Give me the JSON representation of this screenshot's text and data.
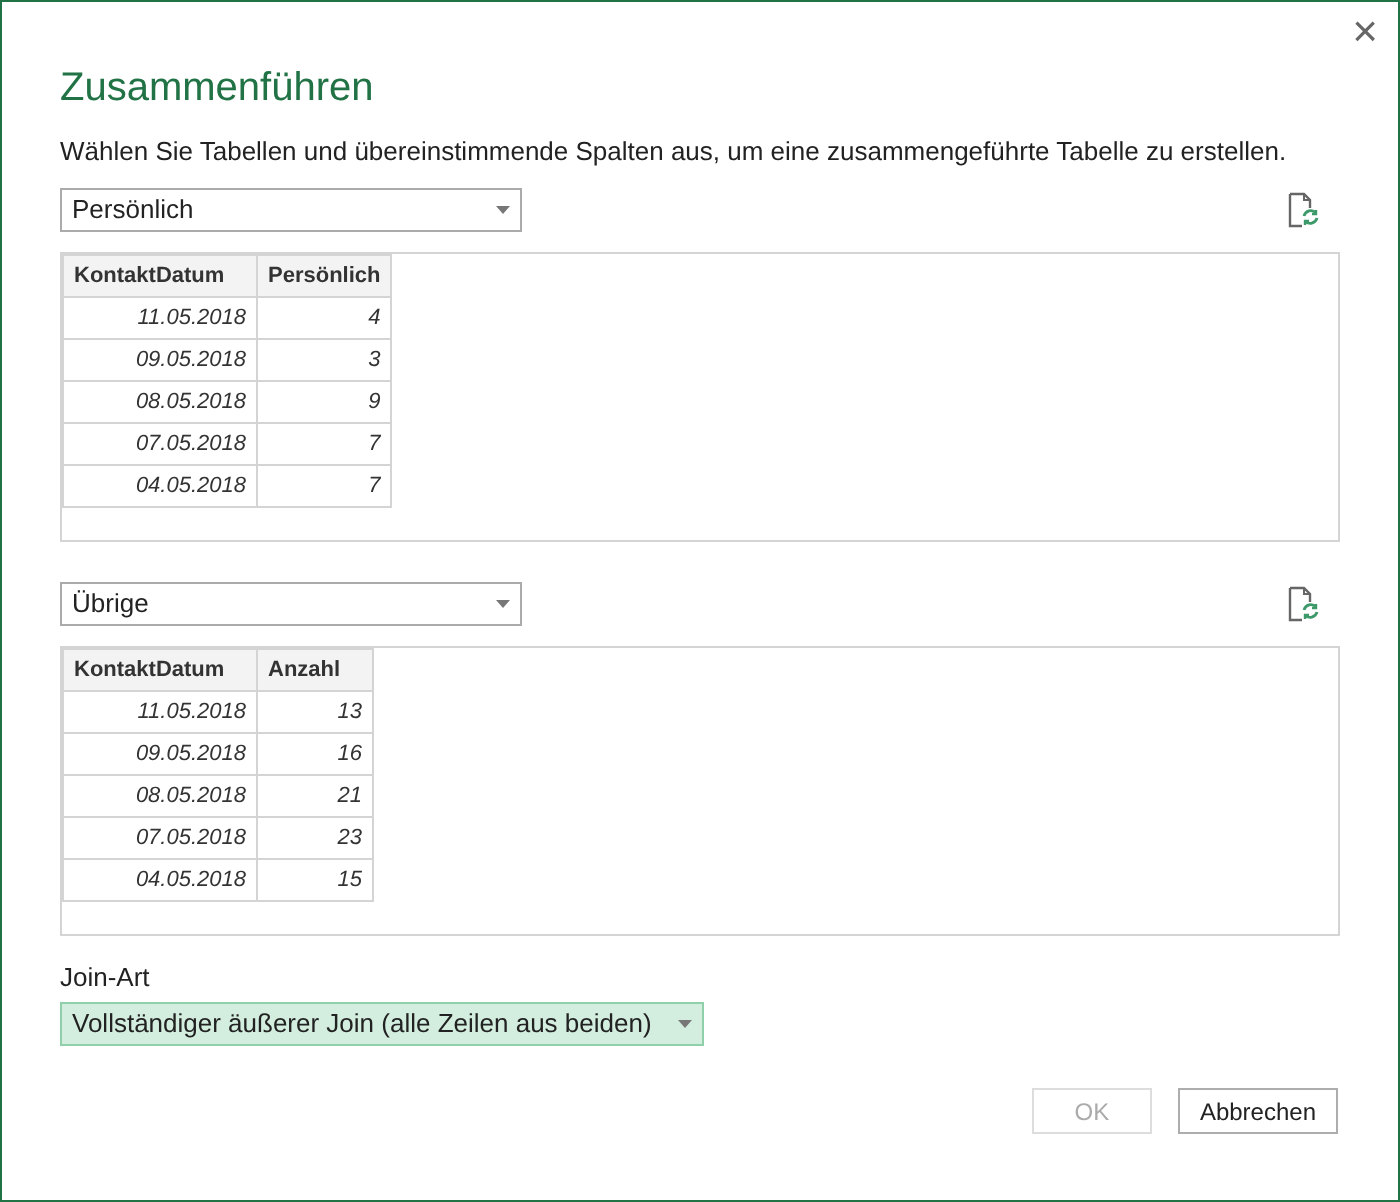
{
  "window": {
    "title": "Zusammenführen",
    "close": "×"
  },
  "description": "Wählen Sie Tabellen und übereinstimmende Spalten aus, um eine zusammengeführte Tabelle zu erstellen.",
  "tables": [
    {
      "dropdown": "Persönlich",
      "columns": [
        "KontaktDatum",
        "Persönlich"
      ],
      "rows": [
        [
          "11.05.2018",
          "4"
        ],
        [
          "09.05.2018",
          "3"
        ],
        [
          "08.05.2018",
          "9"
        ],
        [
          "07.05.2018",
          "7"
        ],
        [
          "04.05.2018",
          "7"
        ]
      ]
    },
    {
      "dropdown": "Übrige",
      "columns": [
        "KontaktDatum",
        "Anzahl"
      ],
      "rows": [
        [
          "11.05.2018",
          "13"
        ],
        [
          "09.05.2018",
          "16"
        ],
        [
          "08.05.2018",
          "21"
        ],
        [
          "07.05.2018",
          "23"
        ],
        [
          "04.05.2018",
          "15"
        ]
      ]
    }
  ],
  "join": {
    "label": "Join-Art",
    "value": "Vollständiger äußerer Join (alle Zeilen aus beiden)"
  },
  "buttons": [
    {
      "label": "OK",
      "disabled": true
    },
    {
      "label": "Abbrechen",
      "disabled": false
    }
  ]
}
